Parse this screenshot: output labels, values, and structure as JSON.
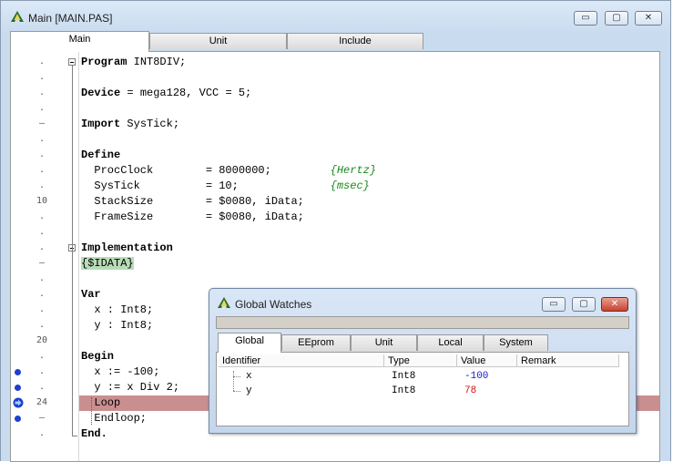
{
  "window": {
    "title": "Main [MAIN.PAS]",
    "buttons": {
      "minimize": "▭",
      "restore": "▢",
      "close": "✕"
    }
  },
  "tabs": [
    "Main",
    "Unit",
    "Include"
  ],
  "gutter": {
    "markers": [
      ".",
      ".",
      ".",
      ".",
      "–",
      ".",
      ".",
      ".",
      ".",
      "10",
      ".",
      ".",
      ".",
      "–",
      ".",
      ".",
      ".",
      ".",
      "20",
      ".",
      ".",
      ".",
      "24",
      "–",
      "."
    ],
    "breakpoints_rows": [
      20,
      21,
      23
    ],
    "current_row": 22
  },
  "code": [
    [
      {
        "t": "Program",
        "k": "kw"
      },
      {
        "t": " INT8DIV;"
      }
    ],
    [],
    [
      {
        "t": "Device",
        "k": "kw"
      },
      {
        "t": " = mega128, VCC = 5;"
      }
    ],
    [],
    [
      {
        "t": "Import",
        "k": "kw"
      },
      {
        "t": " SysTick;"
      }
    ],
    [],
    [
      {
        "t": "Define",
        "k": "kw"
      }
    ],
    [
      {
        "t": "  ProcClock        = 8000000;         "
      },
      {
        "t": "{Hertz}",
        "k": "cmt"
      }
    ],
    [
      {
        "t": "  SysTick          = 10;              "
      },
      {
        "t": "{msec}",
        "k": "cmt"
      }
    ],
    [
      {
        "t": "  StackSize        = $0080, iData;"
      }
    ],
    [
      {
        "t": "  FrameSize        = $0080, iData;"
      }
    ],
    [],
    [
      {
        "t": "Implementation",
        "k": "kw"
      }
    ],
    [
      {
        "t": "{$IDATA}",
        "k": "dir"
      }
    ],
    [],
    [
      {
        "t": "Var",
        "k": "kw"
      }
    ],
    [
      {
        "t": "  x : Int8;"
      }
    ],
    [
      {
        "t": "  y : Int8;"
      }
    ],
    [],
    [
      {
        "t": "Begin",
        "k": "kw"
      }
    ],
    [
      {
        "t": "  x := -100;"
      }
    ],
    [
      {
        "t": "  y := x Div 2;"
      }
    ],
    [
      {
        "t": "  Loop"
      }
    ],
    [
      {
        "t": "  Endloop;"
      }
    ],
    [
      {
        "t": "End.",
        "k": "kw"
      }
    ]
  ],
  "watches": {
    "title": "Global Watches",
    "tabs": [
      "Global",
      "EEprom",
      "Unit",
      "Local",
      "System"
    ],
    "columns": [
      "Identifier",
      "Type",
      "Value",
      "Remark"
    ],
    "rows": [
      {
        "identifier": "x",
        "type": "Int8",
        "value": "-100",
        "remark": "",
        "value_color": "#1a1acc"
      },
      {
        "identifier": "y",
        "type": "Int8",
        "value": "78",
        "remark": "",
        "value_color": "#d01010"
      }
    ]
  },
  "colors": {
    "breakpoint": "#1f3fcf",
    "current_line": "#c98f8f",
    "comment": "#1a8a1a",
    "directive_bg": "#b8dbb8"
  }
}
